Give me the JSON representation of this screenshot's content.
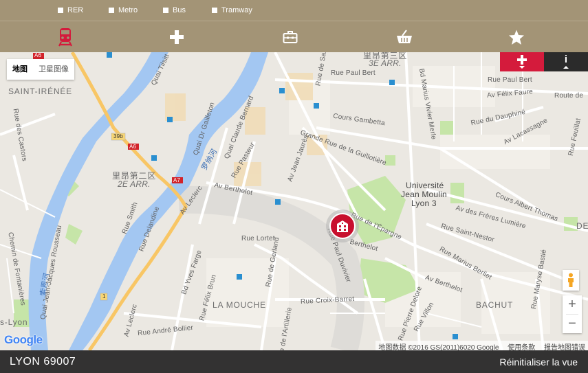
{
  "filters": [
    {
      "label": "RER"
    },
    {
      "label": "Metro"
    },
    {
      "label": "Bus"
    },
    {
      "label": "Tramway"
    }
  ],
  "categories": [
    {
      "icon": "train-icon",
      "active": true
    },
    {
      "icon": "medical-cross-icon"
    },
    {
      "icon": "briefcase-icon"
    },
    {
      "icon": "shopping-basket-icon"
    },
    {
      "icon": "star-icon"
    }
  ],
  "map": {
    "maptype_options": [
      "地图",
      "卫星图像"
    ],
    "maptype_active": "地图",
    "attribution": {
      "data": "地图数据 ©2016 GS(2011)6020 Google",
      "terms": "使用条款",
      "report": "报告地图错误"
    },
    "google_logo": "Google",
    "zoom_in": "+",
    "zoom_out": "−",
    "labels": {
      "arr3_cn": "里昂第三区",
      "arr3": "3E ARR.",
      "arr2_cn": "里昂第二区",
      "arr2": "2E ARR.",
      "saint_irenee": "SAINT-IRÉNÉE",
      "la_mouche": "LA MOUCHE",
      "bachut": "BACHUT",
      "universite": "Université",
      "jean_moulin": "Jean Moulin",
      "lyon3": "Lyon 3",
      "s_lyon": "s-Lyon",
      "rhone_cn": "罗纳河",
      "saone_cn": "索恩河",
      "quai_tilsitt": "Quai Tilsitt",
      "quai_gailleton": "Quai Dr Gailleton",
      "quai_bernard": "Quai Claude Bernard",
      "rue_pasteur": "Rue Pasteur",
      "av_berthelot": "Av Berthelot",
      "av_jean_jaures": "Av Jean Jaurès",
      "grande_rue": "Grande Rue de la Guillotière",
      "cours_gambetta": "Cours Gambetta",
      "rue_paul_bert": "Rue Paul Bert",
      "rue_paul_bert2": "Rue Paul Bert",
      "av_felix_faure": "Av Félix Faure",
      "route_de": "Route de",
      "rue_dauphine": "Rue du Dauphiné",
      "av_lacassagne": "Av Lacassagne",
      "rue_feuillat": "Rue Feuillat",
      "cours_albert_thomas": "Cours Albert Thomas",
      "av_freres_lumiere": "Av des Frères Lumière",
      "rue_saint_nestor": "Rue Saint-Nestor",
      "rue_marius_berliet": "Rue Marius Berliet",
      "av_berthelot2": "Av Berthelot",
      "bd_marius_vivier_merle": "Bd Marius Vivier Merle",
      "rue_de_saxe": "Rue de Saxe",
      "rue_epargne": "Rue de l'Épargne",
      "rue_paul_duvivier": "Rue Paul Duvivier",
      "berthelot3": "Berthelot",
      "rue_lortet": "Rue Lortet",
      "rue_de_gerland": "Rue de Gerland",
      "rue_croix_barret": "Rue Croix-Barret",
      "rue_pierre_delore": "Rue Pierre Delore",
      "rue_villon": "Rue Villon",
      "rue_maryse_bastie": "Rue Maryse Bastié",
      "bd_yves_farge": "Bd Yves Farge",
      "rue_felix_brun": "Rue Félix Brun",
      "av_leclerc": "Av Leclerc",
      "av_leclerc2": "Av Leclerc",
      "rue_smith": "Rue Smith",
      "rue_delandine": "Rue Delandine",
      "rue_andre_bollier": "Rue André Bollier",
      "rue_artillerie": "Rue de l'Artillerie",
      "rue_des_castors": "Rue des Castors",
      "chemin_fontanieres": "Chemin de Fontanières",
      "quai_jjr": "Quai Jean-Jacques Rousseau",
      "de_label": "DE",
      "a6": "A6",
      "a6b": "A6",
      "a7": "A7",
      "r39b": "39b",
      "r1": "1"
    }
  },
  "footer": {
    "location": "LYON 69007",
    "reset_label": "Réinitialiser la vue"
  },
  "colors": {
    "bar": "#a39476",
    "accent": "#d41b3c",
    "footer": "#333232",
    "river": "#a3c7f2",
    "park": "#c6e5a8"
  }
}
